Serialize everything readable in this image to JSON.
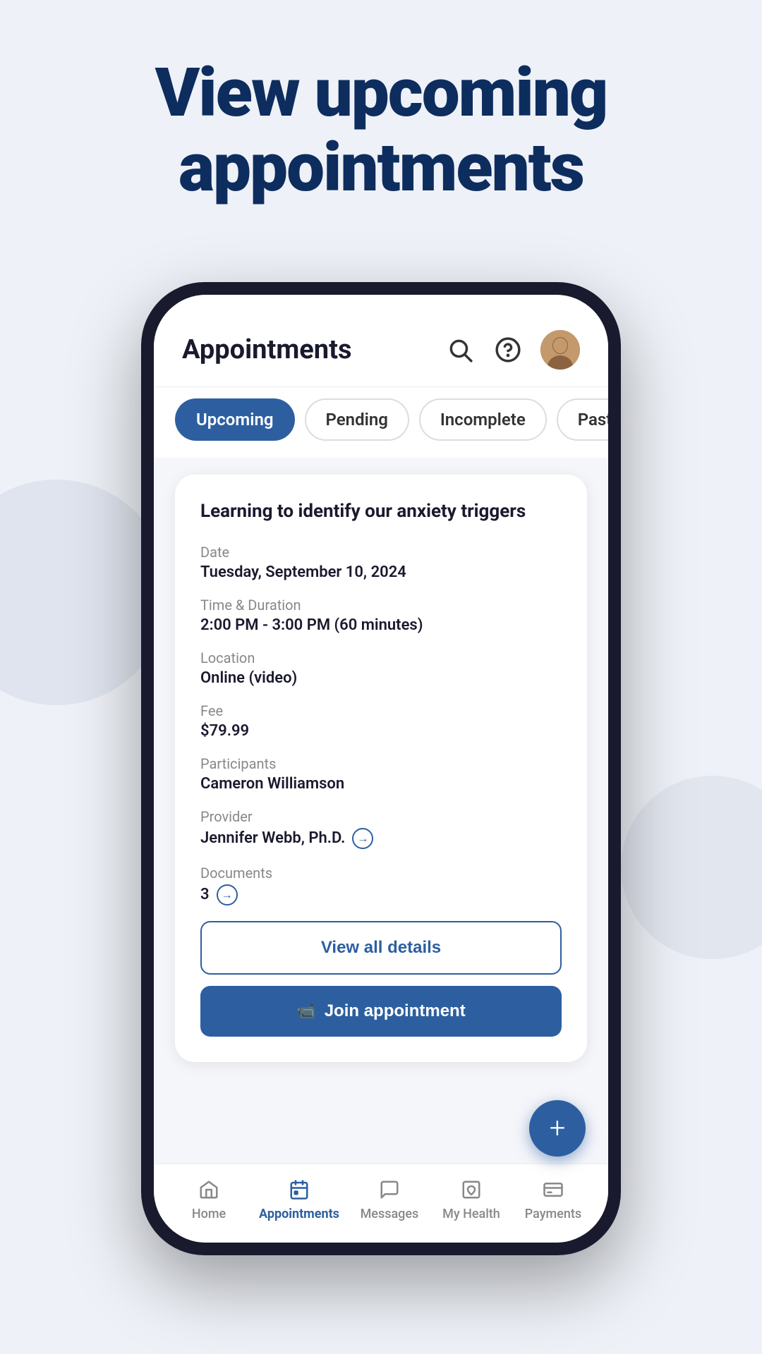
{
  "hero": {
    "title_line1": "View upcoming",
    "title_line2": "appointments"
  },
  "header": {
    "title": "Appointments"
  },
  "tabs": [
    {
      "label": "Upcoming",
      "active": true
    },
    {
      "label": "Pending",
      "active": false
    },
    {
      "label": "Incomplete",
      "active": false
    },
    {
      "label": "Past",
      "active": false
    }
  ],
  "appointment": {
    "title": "Learning to identify our anxiety triggers",
    "date_label": "Date",
    "date_value": "Tuesday, September 10, 2024",
    "time_label": "Time & Duration",
    "time_value": "2:00 PM - 3:00 PM (60 minutes)",
    "location_label": "Location",
    "location_value": "Online (video)",
    "fee_label": "Fee",
    "fee_value": "$79.99",
    "participants_label": "Participants",
    "participants_value": "Cameron Williamson",
    "provider_label": "Provider",
    "provider_value": "Jennifer Webb, Ph.D.",
    "documents_label": "Documents",
    "documents_value": "3"
  },
  "buttons": {
    "view_details": "View all details",
    "join": "Join appointment"
  },
  "nav": {
    "items": [
      {
        "label": "Home",
        "icon": "home-icon",
        "active": false
      },
      {
        "label": "Appointments",
        "icon": "calendar-icon",
        "active": true
      },
      {
        "label": "Messages",
        "icon": "messages-icon",
        "active": false
      },
      {
        "label": "My Health",
        "icon": "myhealth-icon",
        "active": false
      },
      {
        "label": "Payments",
        "icon": "payments-icon",
        "active": false
      }
    ]
  }
}
